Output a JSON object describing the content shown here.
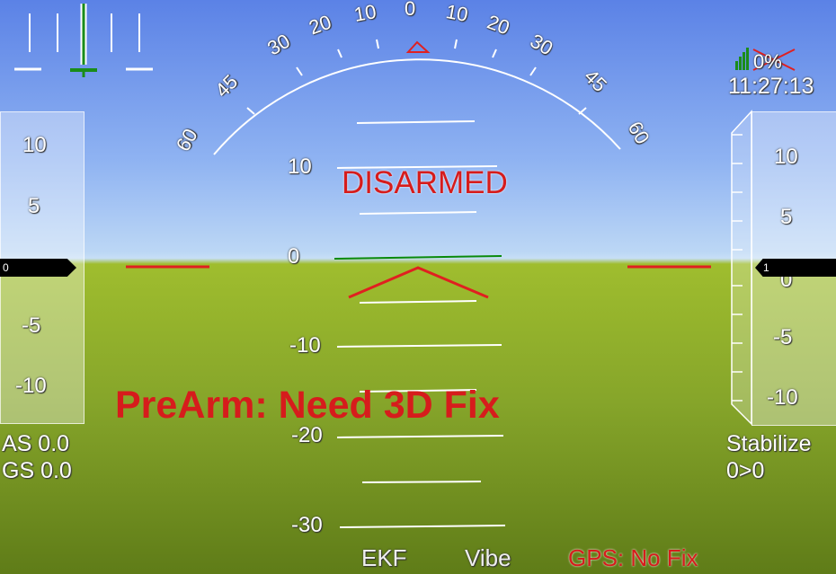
{
  "hud": {
    "disarmed": "DISARMED",
    "prearm_message": "PreArm: Need 3D Fix",
    "battery_percent": "0%",
    "time": "11:27:13",
    "airspeed": "AS 0.0",
    "groundspeed": "GS 0.0",
    "mode": "Stabilize",
    "wp": "0>0",
    "speed_pointer": "0",
    "alt_pointer": "1",
    "ekf": "EKF",
    "vibe": "Vibe",
    "gps": "GPS: No Fix",
    "roll_labels": [
      "60",
      "45",
      "30",
      "20",
      "10",
      "0",
      "10",
      "20",
      "30",
      "45",
      "60"
    ],
    "pitch_labels": [
      "10",
      "0",
      "-10",
      "-20",
      "-30"
    ],
    "speed_tape_labels": [
      "10",
      "5",
      "0",
      "-5",
      "-10"
    ],
    "alt_tape_labels": [
      "10",
      "5",
      "0",
      "-5",
      "-10"
    ],
    "colors": {
      "warning_red": "#d61c1c",
      "horizon_green": "#0a8a0a"
    }
  }
}
